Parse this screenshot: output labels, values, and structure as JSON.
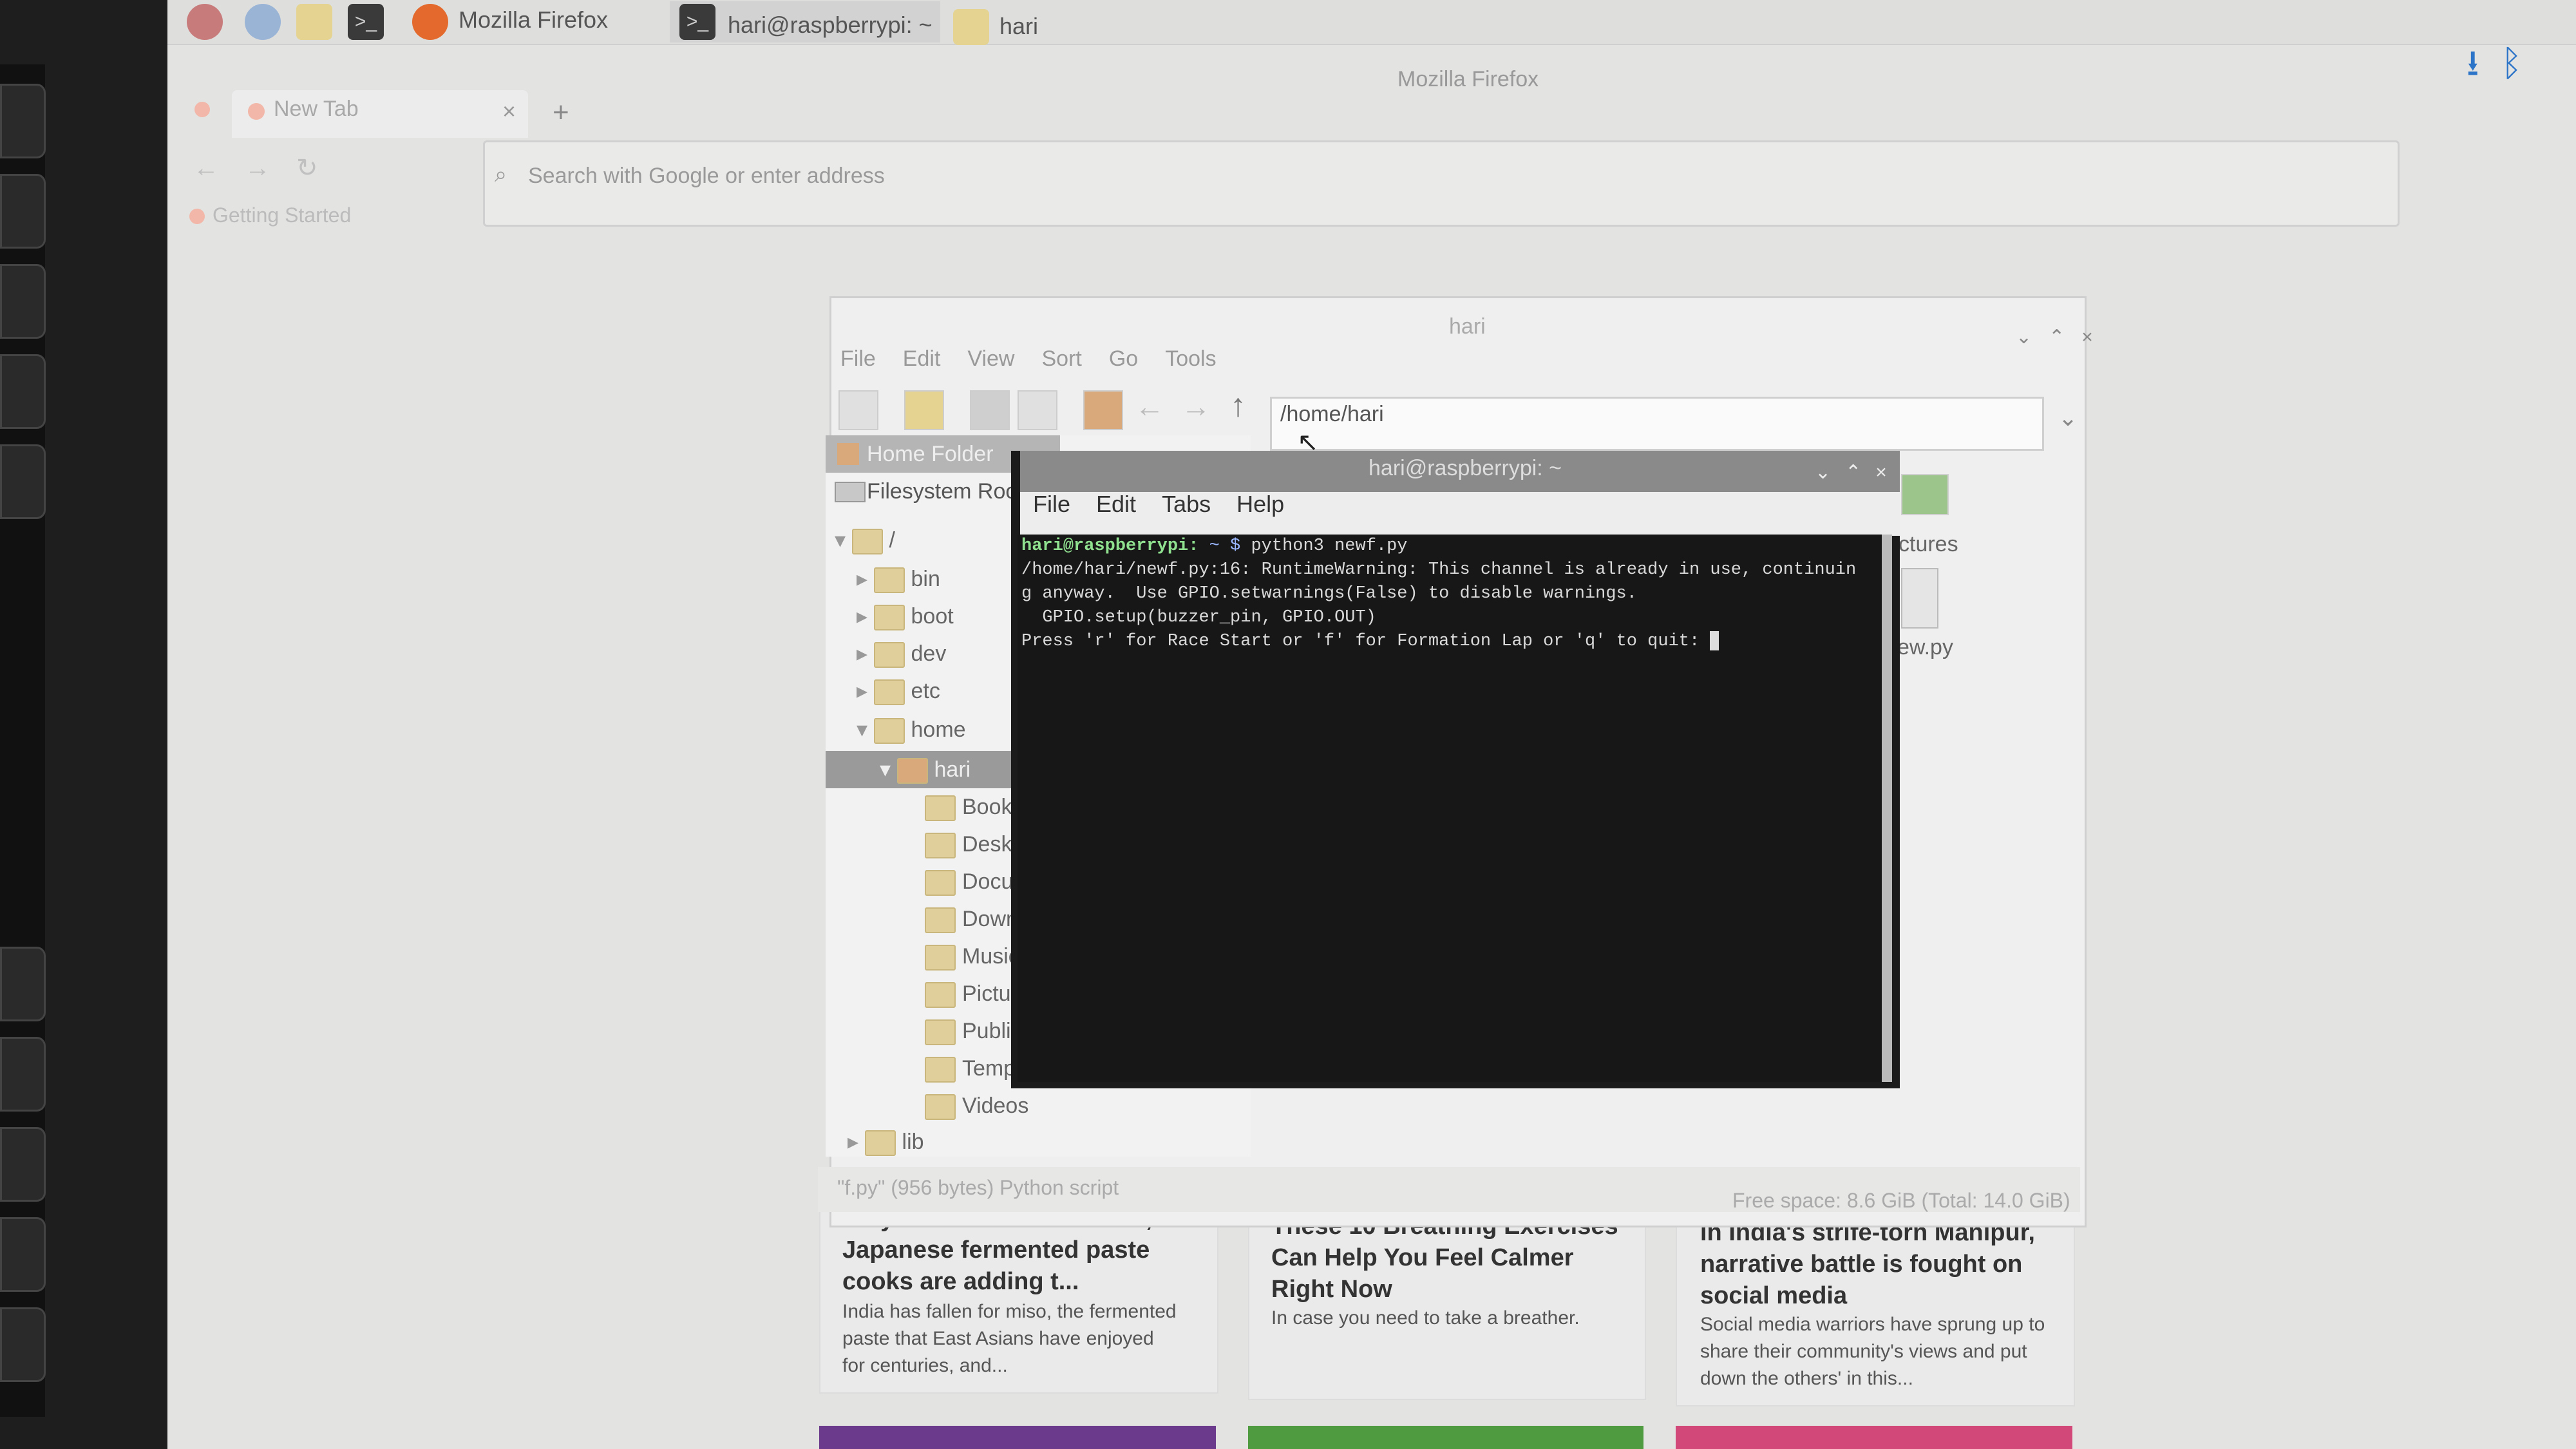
{
  "taskbar": {
    "tasks": [
      {
        "label": "Mozilla Firefox"
      },
      {
        "label": "hari@raspberrypi: ~"
      },
      {
        "label": "hari"
      }
    ]
  },
  "firefox": {
    "window_title": "Mozilla Firefox",
    "tab_label": "New Tab",
    "url_placeholder": "Search with Google or enter address",
    "bookmark": "Getting Started"
  },
  "file_manager": {
    "title": "hari",
    "menu": [
      "File",
      "Edit",
      "View",
      "Sort",
      "Go",
      "Tools"
    ],
    "path": "/home/hari",
    "places": [
      "Home Folder",
      "Filesystem Root"
    ],
    "tree": [
      {
        "label": "/"
      },
      {
        "label": "bin"
      },
      {
        "label": "boot"
      },
      {
        "label": "dev"
      },
      {
        "label": "etc"
      },
      {
        "label": "home"
      },
      {
        "label": "hari"
      },
      {
        "label": "Books"
      },
      {
        "label": "Deskt"
      },
      {
        "label": "Docur"
      },
      {
        "label": "Down"
      },
      {
        "label": "Music"
      },
      {
        "label": "Pictur"
      },
      {
        "label": "Public"
      },
      {
        "label": "Templates"
      },
      {
        "label": "Videos"
      },
      {
        "label": "lib"
      }
    ],
    "visible_files": [
      "ctures",
      "ew.py"
    ],
    "status_left": "\"f.py\" (956 bytes) Python script",
    "status_right": "Free space: 8.6 GiB (Total: 14.0 GiB)"
  },
  "terminal": {
    "title": "hari@raspberrypi: ~",
    "menu": [
      "File",
      "Edit",
      "Tabs",
      "Help"
    ],
    "prompt_user": "hari@raspberrypi:",
    "prompt_dir": "~ $",
    "command": "python3 newf.py",
    "lines": [
      "/home/hari/newf.py:16: RuntimeWarning: This channel is already in use, continuin",
      "g anyway.  Use GPIO.setwarnings(False) to disable warnings.",
      "  GPIO.setup(buzzer_pin, GPIO.OUT)",
      "Press 'r' for Race Start or 'f' for Formation Lap or 'q' to quit: "
    ]
  },
  "news": [
    {
      "title": "Why India is mad for miso, the Japanese fermented paste cooks are adding t...",
      "text": "India has fallen for miso, the fermented paste that East Asians have enjoyed for centuries, and..."
    },
    {
      "title": "These 10 Breathing Exercises Can Help You Feel Calmer Right Now",
      "text": "In case you need to take a breather."
    },
    {
      "title": "In India's strife-torn Manipur, narrative battle is fought on social media",
      "text": "Social media warriors have sprung up to share their community's views and put down the others' in this..."
    }
  ]
}
